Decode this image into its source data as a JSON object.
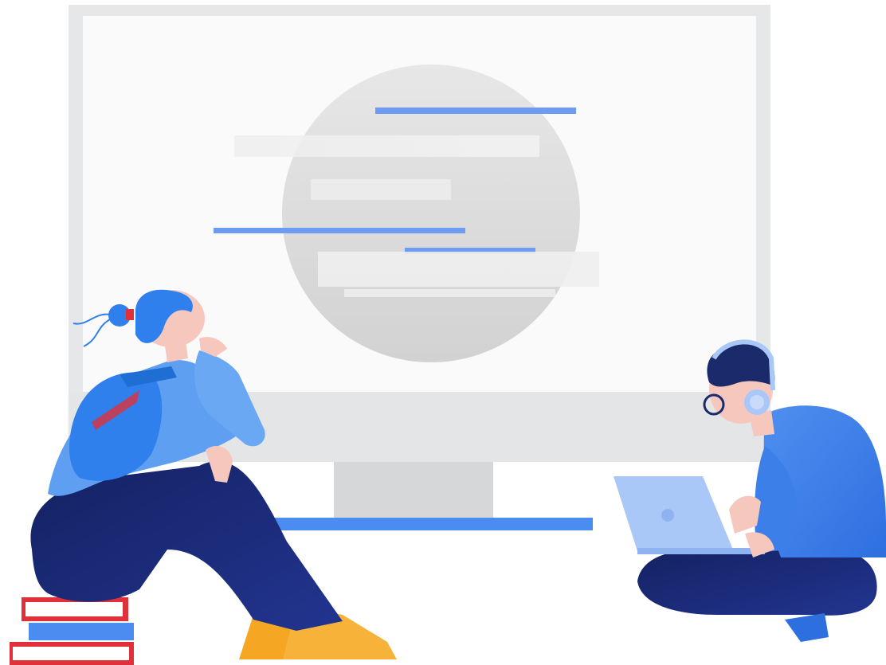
{
  "illustration": {
    "colors": {
      "monitor_frame": "#e6e7e8",
      "monitor_screen": "#fafafa",
      "monitor_chin": "#e4e5e6",
      "stand": "#d6d7d8",
      "stand_base": "#4a8cf0",
      "accent_blue": "#6e9cf2",
      "placeholder_gray": "#e9e9e9",
      "circle_gray": "#dcdcdc",
      "navy": "#1b2a6b",
      "shirt_blue": "#5f9ff2",
      "backpack_blue": "#2f80ed",
      "skin": "#f6c7bd",
      "shoe_orange": "#f5a623",
      "book_red": "#e0313a",
      "book_blue": "#4a8cf0",
      "laptop": "#a9c7f7"
    },
    "icons": [
      "person-thinking-icon",
      "person-laptop-icon",
      "book-stack-icon",
      "headphones-icon",
      "backpack-icon"
    ]
  }
}
